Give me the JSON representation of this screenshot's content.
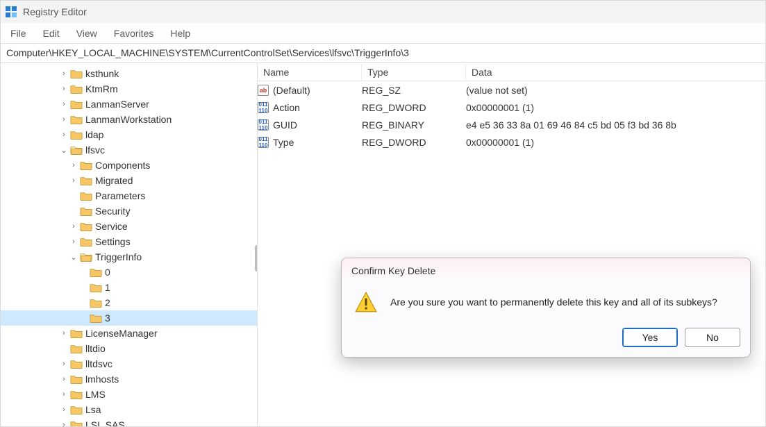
{
  "app": {
    "title": "Registry Editor"
  },
  "menu": {
    "file": "File",
    "edit": "Edit",
    "view": "View",
    "favorites": "Favorites",
    "help": "Help"
  },
  "address": {
    "path": "Computer\\HKEY_LOCAL_MACHINE\\SYSTEM\\CurrentControlSet\\Services\\lfsvc\\TriggerInfo\\3"
  },
  "tree": {
    "ksthunk": "ksthunk",
    "ktmrm": "KtmRm",
    "lanmanserver": "LanmanServer",
    "lanmanworkstation": "LanmanWorkstation",
    "ldap": "ldap",
    "lfsvc": "lfsvc",
    "components": "Components",
    "migrated": "Migrated",
    "parameters": "Parameters",
    "security": "Security",
    "service": "Service",
    "settings": "Settings",
    "triggerinfo": "TriggerInfo",
    "t0": "0",
    "t1": "1",
    "t2": "2",
    "t3": "3",
    "licensemanager": "LicenseManager",
    "lltdio": "lltdio",
    "lltdsvc": "lltdsvc",
    "lmhosts": "lmhosts",
    "lms": "LMS",
    "lsa": "Lsa",
    "lsi_sas": "LSI_SAS"
  },
  "columns": {
    "name": "Name",
    "type": "Type",
    "data": "Data"
  },
  "values": [
    {
      "icon": "str",
      "name": "(Default)",
      "type": "REG_SZ",
      "data": "(value not set)"
    },
    {
      "icon": "bin",
      "name": "Action",
      "type": "REG_DWORD",
      "data": "0x00000001 (1)"
    },
    {
      "icon": "bin",
      "name": "GUID",
      "type": "REG_BINARY",
      "data": "e4 e5 36 33 8a 01 69 46 84 c5 bd 05 f3 bd 36 8b"
    },
    {
      "icon": "bin",
      "name": "Type",
      "type": "REG_DWORD",
      "data": "0x00000001 (1)"
    }
  ],
  "dialog": {
    "title": "Confirm Key Delete",
    "message": "Are you sure you want to permanently delete this key and all of its subkeys?",
    "yes": "Yes",
    "no": "No"
  }
}
